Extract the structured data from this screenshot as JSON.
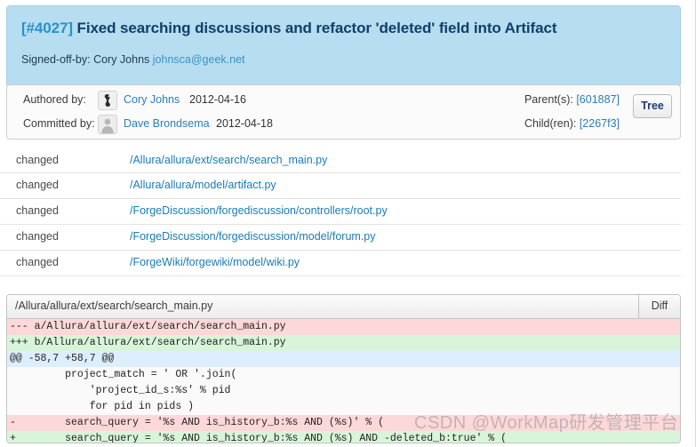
{
  "commit": {
    "rev_label": "[#4027]",
    "title": "Fixed searching discussions and refactor 'deleted' field into Artifact",
    "signed_off_prefix": "Signed-off-by: Cory Johns ",
    "signed_off_email": "johnsca@geek.net"
  },
  "meta": {
    "authored_label": "Authored by:",
    "authored_person": "Cory Johns",
    "authored_date": "2012-04-16",
    "committed_label": "Committed by:",
    "committed_person": "Dave Brondsema",
    "committed_date": "2012-04-18",
    "parents_label": "Parent(s): ",
    "parents_hash": "[601887]",
    "children_label": "Child(ren): ",
    "children_hash": "[2267f3]",
    "tree_button": "Tree",
    "author_avatar_icon": "cory-johns-avatar-icon",
    "committer_avatar_icon": "person-silhouette-icon"
  },
  "files": [
    {
      "status": "changed",
      "path": "/Allura/allura/ext/search/search_main.py"
    },
    {
      "status": "changed",
      "path": "/Allura/allura/model/artifact.py"
    },
    {
      "status": "changed",
      "path": "/ForgeDiscussion/forgediscussion/controllers/root.py"
    },
    {
      "status": "changed",
      "path": "/ForgeDiscussion/forgediscussion/model/forum.py"
    },
    {
      "status": "changed",
      "path": "/ForgeWiki/forgewiki/model/wiki.py"
    }
  ],
  "diff": {
    "file_header": "/Allura/allura/ext/search/search_main.py",
    "tab_label": "Diff",
    "lines": [
      {
        "kind": "del",
        "text": "--- a/Allura/allura/ext/search/search_main.py"
      },
      {
        "kind": "add",
        "text": "+++ b/Allura/allura/ext/search/search_main.py"
      },
      {
        "kind": "hunk",
        "text": "@@ -58,7 +58,7 @@"
      },
      {
        "kind": "ctx",
        "text": "         project_match = ' OR '.join("
      },
      {
        "kind": "ctx",
        "text": "             'project_id_s:%s' % pid"
      },
      {
        "kind": "ctx",
        "text": "             for pid in pids )"
      },
      {
        "kind": "del",
        "text": "-        search_query = '%s AND is_history_b:%s AND (%s)' % ("
      },
      {
        "kind": "add",
        "text": "+        search_query = '%s AND is_history_b:%s AND (%s) AND -deleted_b:true' % ("
      }
    ]
  },
  "watermark": {
    "text": "CSDN @WorkMap研发管理平台"
  },
  "colors": {
    "header_bg": "#b6ddf0",
    "title_text": "#103f6b",
    "link": "#1a7cb5",
    "diff_del_bg": "#fdd8da",
    "diff_add_bg": "#d9f5d9",
    "diff_hunk_bg": "#ddeeff"
  }
}
